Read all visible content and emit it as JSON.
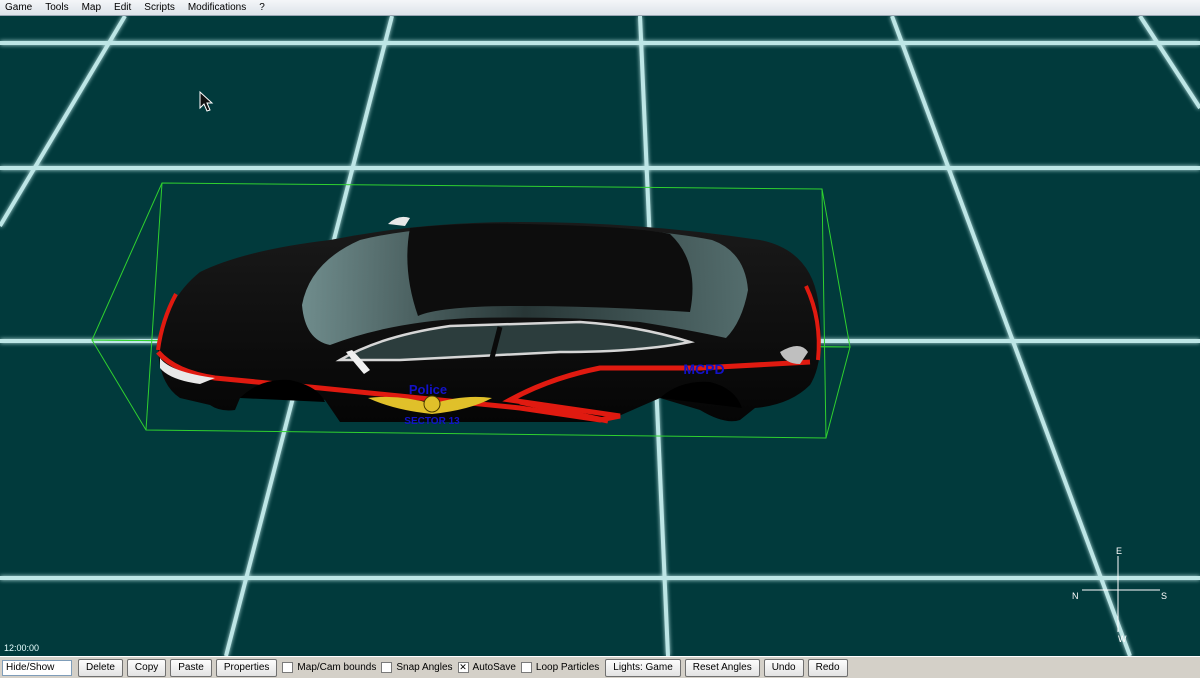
{
  "menu": [
    "Game",
    "Tools",
    "Map",
    "Edit",
    "Scripts",
    "Modifications",
    "?"
  ],
  "viewport": {
    "time": "12:00:00",
    "vehicle_decals": {
      "police": "Police",
      "sector": "SECTOR 13",
      "unit": "MCPD"
    },
    "compass": {
      "north": "N",
      "south": "S",
      "east": "E",
      "west": "W"
    },
    "colors": {
      "background": "#013a3c",
      "grid": "#c8f0f0",
      "selection_box": "#2fd02f",
      "car_body": "#0e0e0e",
      "stripe": "#e01a10",
      "decal_text": "#1212c8"
    }
  },
  "toolbar": {
    "input_value": "Hide/Show",
    "buttons": {
      "delete": "Delete",
      "copy": "Copy",
      "paste": "Paste",
      "properties": "Properties",
      "lights": "Lights: Game",
      "reset_angles": "Reset Angles",
      "undo": "Undo",
      "redo": "Redo"
    },
    "checkboxes": [
      {
        "label": "Map/Cam bounds",
        "checked": false
      },
      {
        "label": "Snap Angles",
        "checked": false
      },
      {
        "label": "AutoSave",
        "checked": true
      },
      {
        "label": "Loop Particles",
        "checked": false
      }
    ]
  }
}
